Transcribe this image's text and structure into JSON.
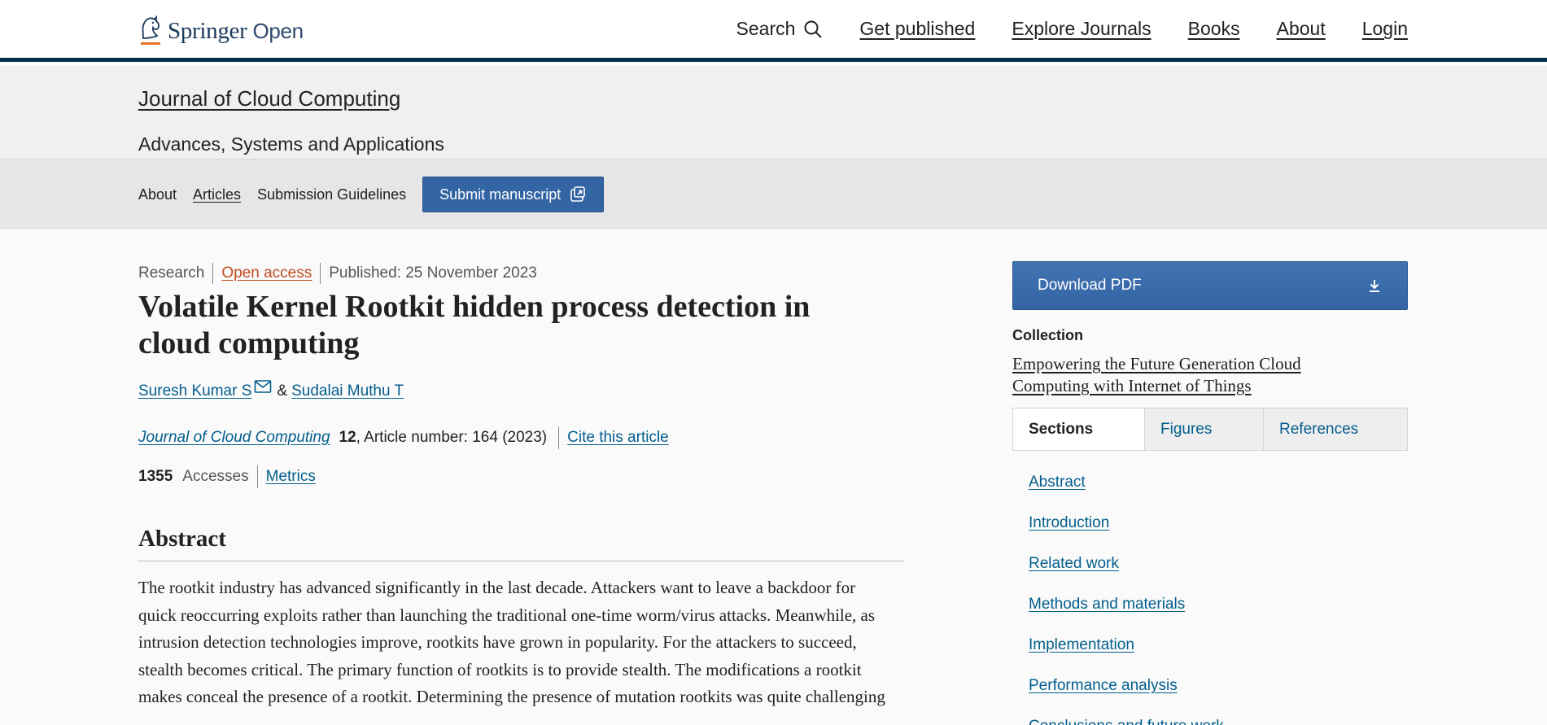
{
  "header": {
    "logo": {
      "brand": "Springer",
      "suffix": "Open"
    },
    "nav": {
      "search_label": "Search",
      "items": [
        "Get published",
        "Explore Journals",
        "Books",
        "About",
        "Login"
      ]
    }
  },
  "journal": {
    "title": "Journal of Cloud Computing",
    "subtitle": "Advances, Systems and Applications",
    "nav": {
      "about": "About",
      "articles": "Articles",
      "guidelines": "Submission Guidelines",
      "submit": "Submit manuscript"
    }
  },
  "article": {
    "type": "Research",
    "access": "Open access",
    "published": "Published: 25 November 2023",
    "title": "Volatile Kernel Rootkit hidden process detection in cloud computing",
    "authors": [
      {
        "name": "Suresh Kumar S"
      },
      {
        "name": "Sudalai Muthu T"
      }
    ],
    "author_separator": "&",
    "citation": {
      "journal": "Journal of Cloud Computing",
      "volume": "12",
      "rest": ", Article number: 164 (2023)",
      "cite_label": "Cite this article"
    },
    "metrics": {
      "accesses_count": "1355",
      "accesses_label": "Accesses",
      "metrics_link": "Metrics"
    },
    "abstract_heading": "Abstract",
    "abstract_text": "The rootkit industry has advanced significantly in the last decade. Attackers want to leave a backdoor for quick reoccurring exploits rather than launching the traditional one-time worm/virus attacks. Meanwhile, as intrusion detection technologies improve, rootkits have grown in popularity. For the attackers to succeed, stealth becomes critical. The primary function of rootkits is to provide stealth. The modifications a rootkit makes conceal the presence of a rootkit. Determining the presence of mutation rootkits was quite challenging"
  },
  "sidebar": {
    "download_label": "Download PDF",
    "collection_label": "Collection",
    "collection_title": "Empowering the Future Generation Cloud Computing with Internet of Things",
    "tabs": [
      "Sections",
      "Figures",
      "References"
    ],
    "active_tab": "Sections",
    "sections": [
      "Abstract",
      "Introduction",
      "Related work",
      "Methods and materials",
      "Implementation",
      "Performance analysis",
      "Conclusions and future work"
    ]
  },
  "colors": {
    "link": "#025e8d",
    "primary_button": "#3365a4",
    "open_access": "#c04b1e",
    "header_rule": "#01324b"
  }
}
